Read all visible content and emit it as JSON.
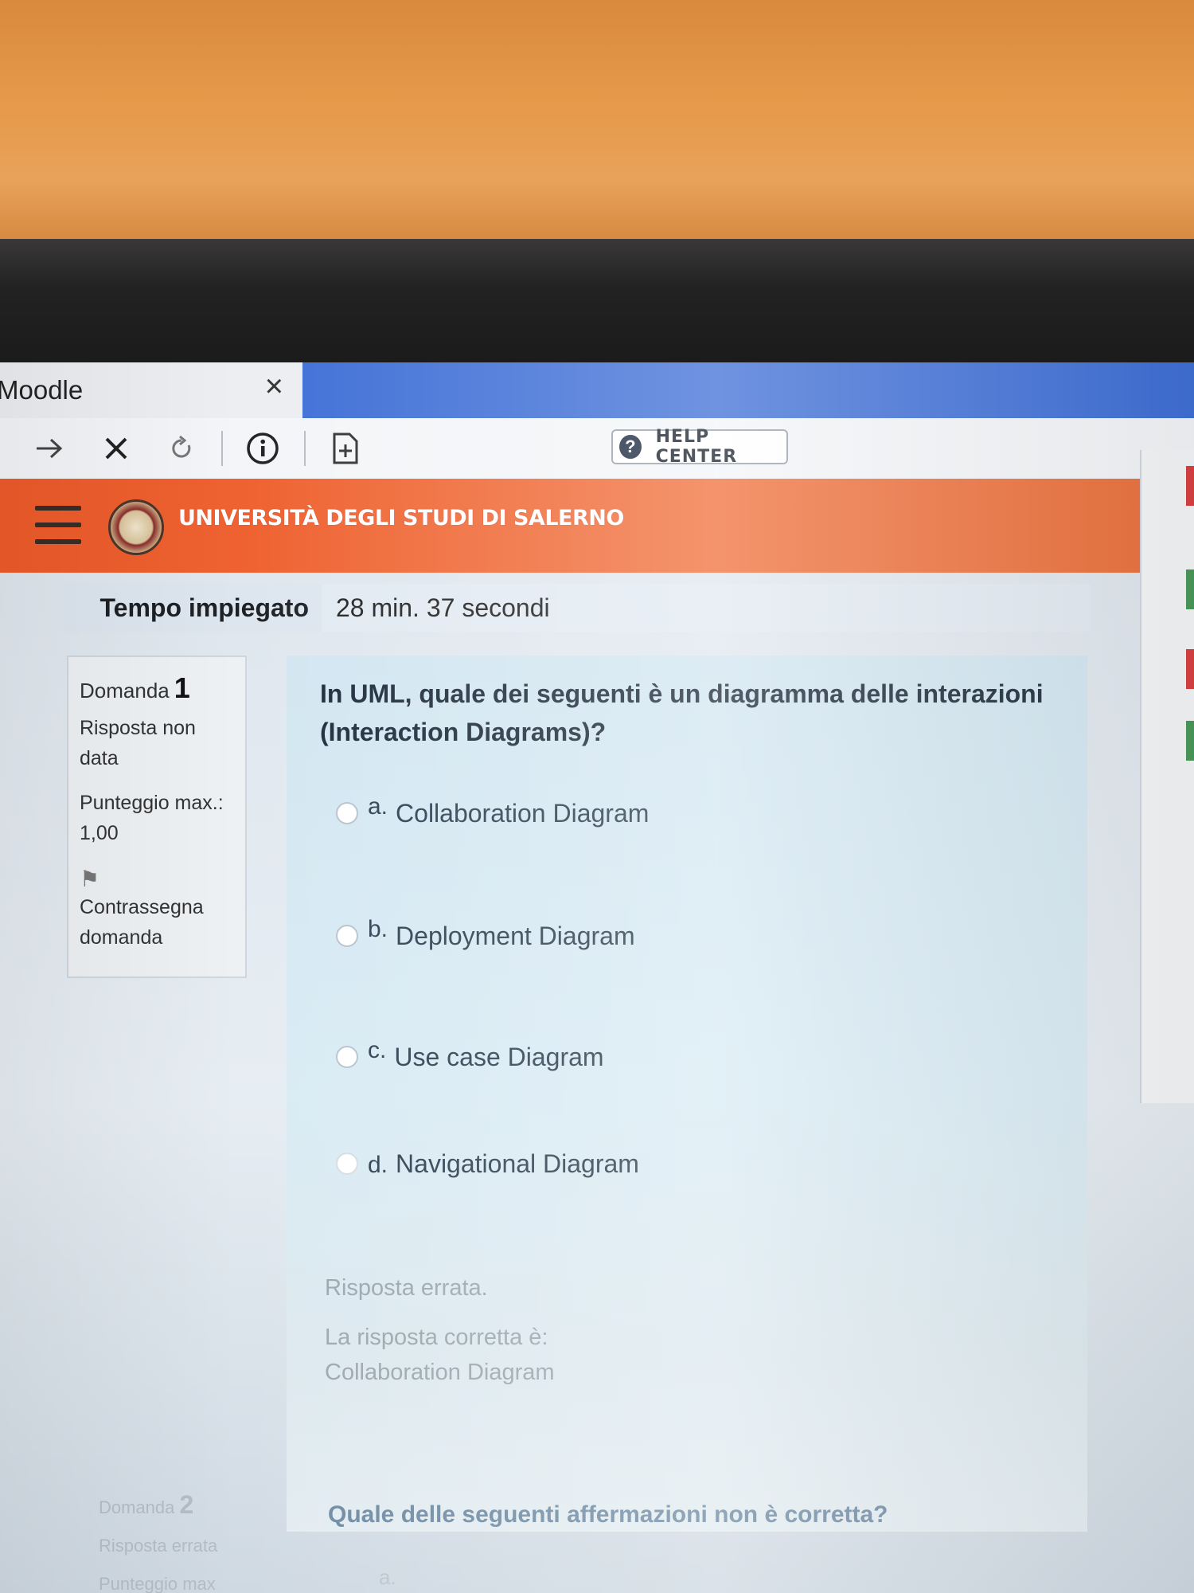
{
  "browser": {
    "tab_title": "Moodle",
    "tab_close": "×",
    "help_center": "HELP CENTER",
    "help_icon": "?"
  },
  "header": {
    "university": "UNIVERSITÀ DEGLI STUDI DI SALERNO"
  },
  "summary": {
    "time_label": "Tempo impiegato",
    "time_value": "28 min. 37 secondi"
  },
  "question1": {
    "label": "Domanda",
    "number": "1",
    "status_line1": "Risposta non",
    "status_line2": "data",
    "score_label": "Punteggio max.:",
    "score_value": "1,00",
    "flag_label_line1": "Contrassegna",
    "flag_label_line2": "domanda",
    "text": "In UML, quale dei seguenti è un diagramma delle interazioni (Interaction Diagrams)?",
    "options": [
      {
        "letter": "a.",
        "text": "Collaboration Diagram"
      },
      {
        "letter": "b.",
        "text": "Deployment Diagram"
      },
      {
        "letter": "c.",
        "text": "Use case Diagram"
      },
      {
        "letter": "d.",
        "text": "Navigational Diagram"
      }
    ],
    "feedback": "Risposta errata.",
    "correct_label": "La risposta corretta è:",
    "correct_answer": "Collaboration Diagram"
  },
  "question2": {
    "label": "Domanda",
    "number": "2",
    "status": "Risposta errata",
    "score_label": "Punteggio max",
    "text": "Quale delle seguenti affermazioni non è corretta?"
  },
  "colors": {
    "header_orange": "#ee5a2a",
    "tab_blue": "#3f6fd6",
    "formulation_bg": "#d9ebf4"
  }
}
